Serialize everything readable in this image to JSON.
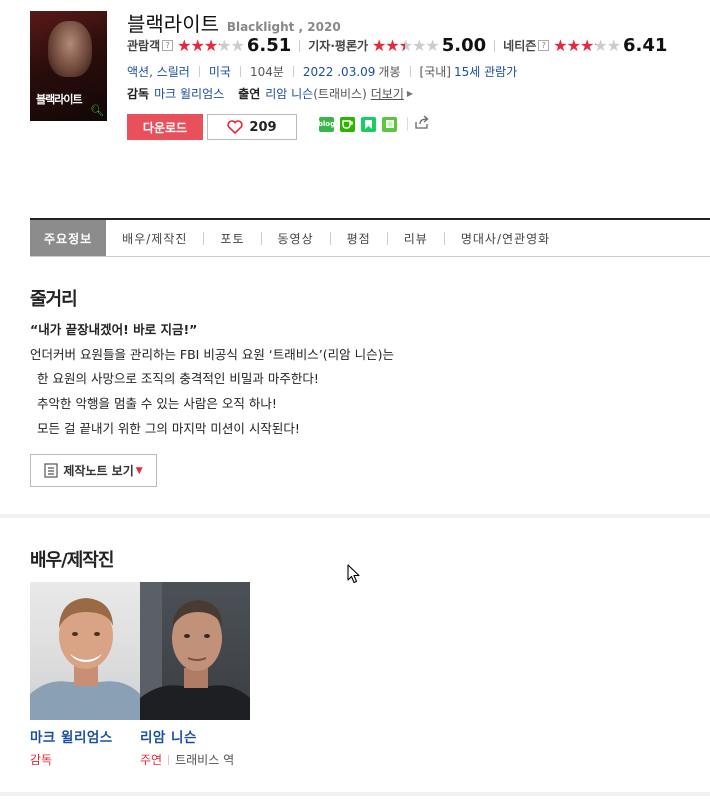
{
  "movie": {
    "title_ko": "블랙라이트",
    "title_en": "Blacklight , 2020",
    "poster_text": "블랙라이트"
  },
  "ratings": [
    {
      "label": "관람객",
      "help": "?",
      "stars": 3.25,
      "score": "6.51"
    },
    {
      "label": "기자·평론가",
      "help": "",
      "stars": 2.5,
      "score": "5.00"
    },
    {
      "label": "네티즌",
      "help": "?",
      "stars": 3.2,
      "score": "6.41"
    }
  ],
  "meta": {
    "genre": "액션, 스릴러",
    "country": "미국",
    "runtime": "104분",
    "release_date": "2022 .03.09",
    "release_suffix": "개봉",
    "rating_prefix": "[국내]",
    "rating": "15세 관람가"
  },
  "credits": {
    "director_label": "감독",
    "director": "마크 윌리엄스",
    "cast_label": "출연",
    "lead": "리암 니슨",
    "lead_role": "(트래비스)",
    "more": "더보기"
  },
  "actions": {
    "download": "다운로드",
    "like_count": "209"
  },
  "share_icons": [
    "blog-icon",
    "cafe-icon",
    "bookmark-icon",
    "memo-icon",
    "share-icon"
  ],
  "tabs": [
    "주요정보",
    "배우/제작진",
    "포토",
    "동영상",
    "평점",
    "리뷰",
    "명대사/연관영화"
  ],
  "story": {
    "heading": "줄거리",
    "tagline": "“내가 끝장내겠어! 바로 지금!”",
    "lines": [
      "언더커버 요원들을 관리하는 FBI 비공식 요원 ‘트래비스’(리암 니슨)는",
      "한 요원의 사망으로 조직의 충격적인 비밀과 마주한다!",
      "추악한 악행을 멈출 수 있는 사람은 오직 하나!",
      "모든 걸 끝내기 위한 그의 마지막 미션이 시작된다!"
    ],
    "note_button": "제작노트 보기"
  },
  "cast_section": {
    "heading": "배우/제작진",
    "people": [
      {
        "name": "마크 윌리엄스",
        "role_type": "감독",
        "character": ""
      },
      {
        "name": "리암 니슨",
        "role_type": "주연",
        "character": "트래비스 역"
      }
    ]
  },
  "colors": {
    "accent_red": "#e8283c",
    "download_red": "#e8505b",
    "link_blue": "#1b4ea0",
    "tab_active": "#8c8c8c"
  }
}
